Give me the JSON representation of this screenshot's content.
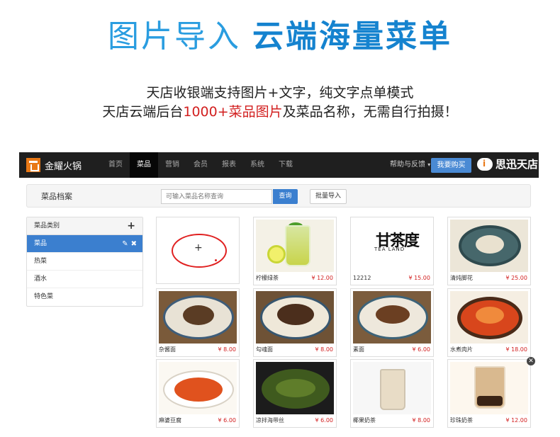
{
  "hero": {
    "title_light": "图片导入",
    "title_bold": "云端海量菜单",
    "line1": "天店收银端支持图片+文字，纯文字点单模式",
    "line2_prefix": "天店云端后台",
    "line2_highlight": "1000+菜品图片",
    "line2_suffix": "及菜品名称，无需自行拍摄！"
  },
  "topbar": {
    "logo_text": "金耀火锅",
    "nav": [
      "首页",
      "菜品",
      "营销",
      "会员",
      "报表",
      "系统",
      "下载"
    ],
    "active_nav": "菜品",
    "help_label": "帮助与反馈",
    "buy_label": "我要购买",
    "brand_label": "思迅天店"
  },
  "page": {
    "title": "菜品档案",
    "search_placeholder": "可输入菜品名称查询",
    "search_button": "查询",
    "import_button": "批量导入"
  },
  "sidebar": {
    "header": "菜品类别",
    "items": [
      "菜品",
      "热菜",
      "酒水",
      "特色菜"
    ],
    "active_item": "菜品"
  },
  "dishes": [
    {
      "name": "柠檬绿茶",
      "price": "¥ 12.00"
    },
    {
      "name": "12212",
      "price": "¥ 15.00"
    },
    {
      "name": "清炖脚花",
      "price": "¥ 25.00"
    },
    {
      "name": "杂酱面",
      "price": "¥ 8.00"
    },
    {
      "name": "勾魂面",
      "price": "¥ 8.00"
    },
    {
      "name": "素面",
      "price": "¥ 6.00"
    },
    {
      "name": "水煮肉片",
      "price": "¥ 18.00"
    },
    {
      "name": "麻婆豆腐",
      "price": "¥ 6.00"
    },
    {
      "name": "凉拌海带丝",
      "price": "¥ 6.00"
    },
    {
      "name": "椰果奶茶",
      "price": "¥ 8.00"
    },
    {
      "name": "珍珠奶茶",
      "price": "¥ 12.00"
    }
  ],
  "tea_logo": {
    "main": "甘茶度",
    "sub": "TEA LAND"
  },
  "colors": {
    "accent_blue": "#3b7fcf",
    "price_red": "#d21f1f",
    "hero_blue": "#1583cf"
  }
}
